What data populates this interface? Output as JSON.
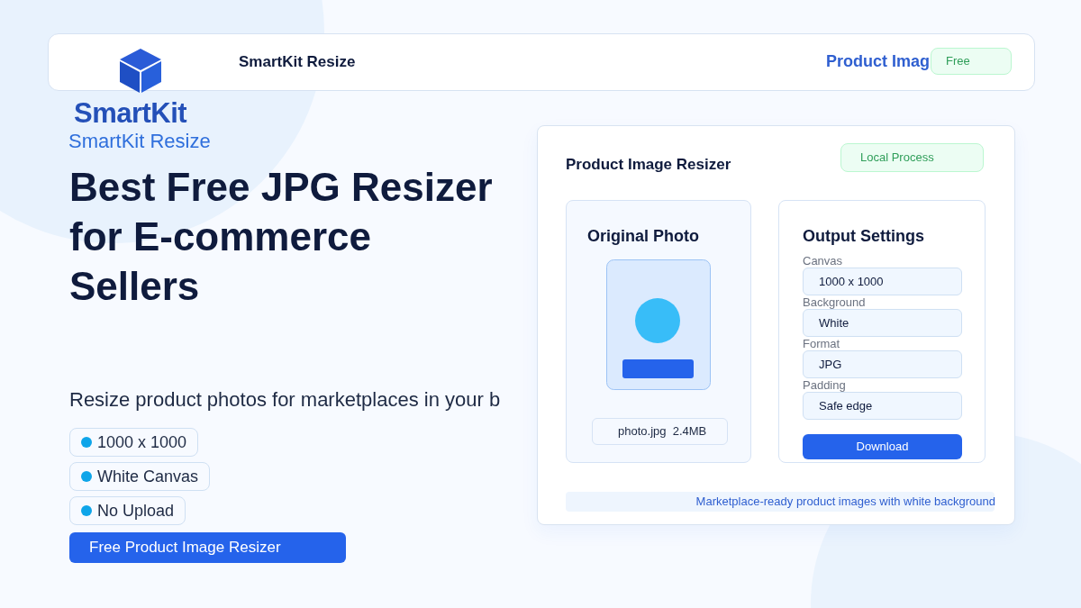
{
  "header": {
    "title": "SmartKit Resize",
    "nav_link": "Product Imag",
    "badge": "Free"
  },
  "logo": {
    "name": "SmartKit",
    "subtitle": "SmartKit Resize"
  },
  "hero": {
    "headline_lines": [
      "Best Free JPG Resizer",
      "for E-commerce",
      "Sellers"
    ],
    "subtitle": "Resize product photos for marketplaces in your b",
    "features": [
      {
        "label": "1000 x 1000",
        "color": "#0ea5e9"
      },
      {
        "label": "White Canvas",
        "color": "#0ea5e9"
      },
      {
        "label": "No Upload",
        "color": "#0ea5e9"
      }
    ],
    "cta": "Free Product Image Resizer"
  },
  "card": {
    "title": "Product Image Resizer",
    "badge": "Local Process",
    "original": {
      "title": "Original Photo",
      "file": "photo.jpg  2.4MB"
    },
    "settings": {
      "title": "Output Settings",
      "fields": [
        {
          "label": "Canvas",
          "value": "1000 x 1000"
        },
        {
          "label": "Background",
          "value": "White"
        },
        {
          "label": "Format",
          "value": "JPG"
        },
        {
          "label": "Padding",
          "value": "Safe edge"
        }
      ],
      "button": "Download"
    },
    "footer": "Marketplace-ready product images with white background"
  }
}
